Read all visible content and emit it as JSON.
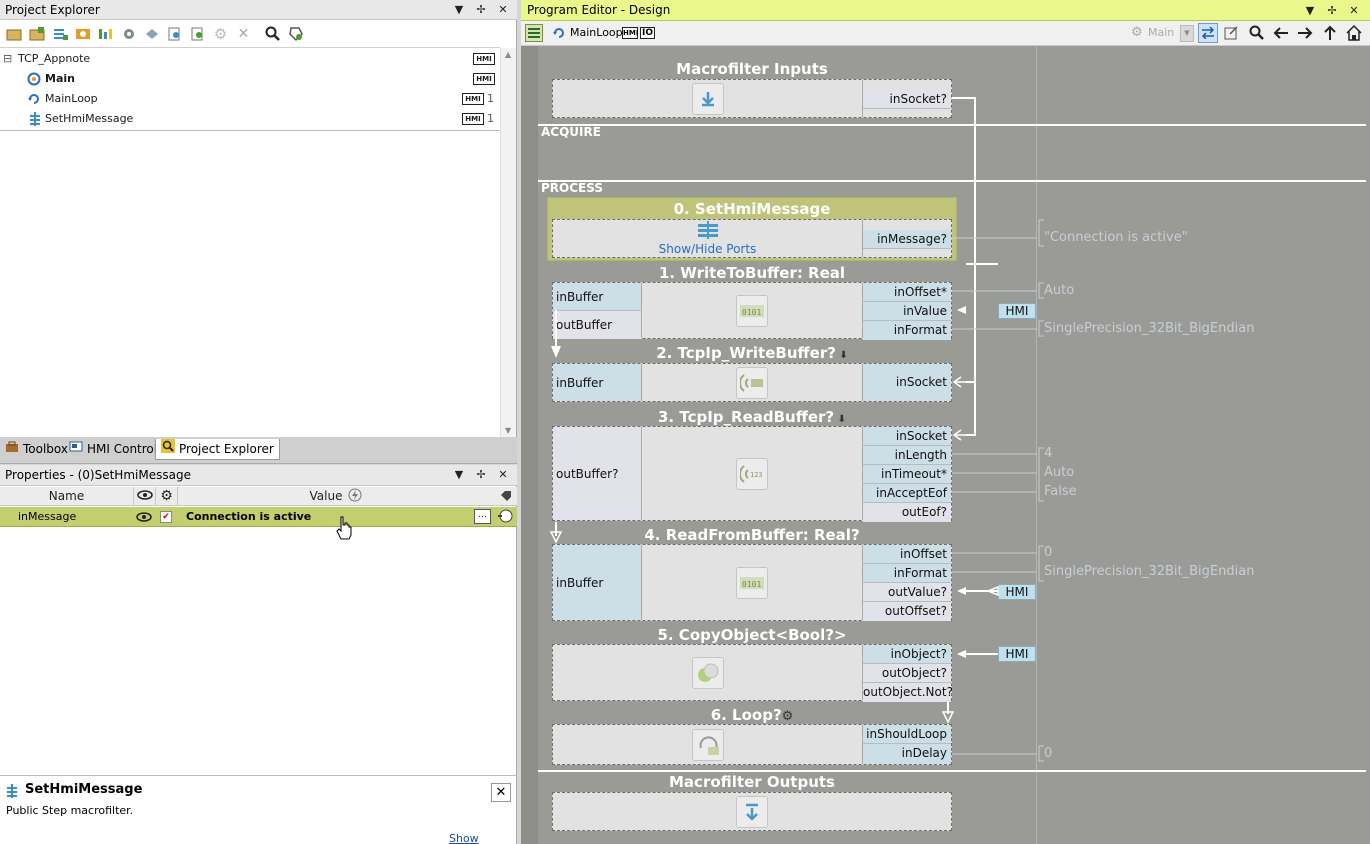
{
  "project_explorer": {
    "title": "Project Explorer",
    "tree": [
      {
        "label": "TCP_Appnote",
        "badge": "HMI",
        "count": ""
      },
      {
        "label": "Main",
        "badge": "HMI",
        "count": ""
      },
      {
        "label": "MainLoop",
        "badge": "HMI",
        "count": "1"
      },
      {
        "label": "SetHmiMessage",
        "badge": "HMI",
        "count": "1"
      }
    ],
    "expander": "⊟"
  },
  "tabs": [
    "Toolbox",
    "HMI Controls",
    "Project Explorer"
  ],
  "properties": {
    "title": "Properties - (0)SetHmiMessage",
    "col_name": "Name",
    "col_value": "Value",
    "row": {
      "name": "inMessage",
      "value": "Connection is active",
      "ellipsis": "..."
    }
  },
  "help": {
    "title": "SetHmiMessage",
    "description": "Public Step macrofilter.",
    "link": "Show help..."
  },
  "editor": {
    "title": "Program Editor - Design",
    "breadcrumb": "MainLoop",
    "hmi_badge": "HMI",
    "io_badge": "IO",
    "main_selector": "Main",
    "sections": {
      "acquire": "ACQUIRE",
      "process": "PROCESS"
    },
    "inputs_title": "Macrofilter Inputs",
    "outputs_title": "Macrofilter Outputs",
    "inputs_port": "inSocket?",
    "show_hide": "Show/Hide Ports",
    "hmi_label": "HMI",
    "filters": [
      {
        "title": "0. SetHmiMessage",
        "left": [],
        "right": [
          "inMessage?"
        ],
        "values": [
          "\"Connection is active\""
        ]
      },
      {
        "title": "1. WriteToBuffer: Real",
        "left": [
          "inBuffer",
          "outBuffer"
        ],
        "right": [
          "inOffset*",
          "inValue",
          "inFormat"
        ],
        "values": [
          "Auto",
          "",
          "SinglePrecision_32Bit_BigEndian"
        ]
      },
      {
        "title": "2. TcpIp_WriteBuffer?",
        "left": [
          "inBuffer"
        ],
        "right": [
          "inSocket"
        ],
        "values": []
      },
      {
        "title": "3. TcpIp_ReadBuffer?",
        "left": [
          "outBuffer?"
        ],
        "right": [
          "inSocket",
          "inLength",
          "inTimeout*",
          "inAcceptEof",
          "outEof?"
        ],
        "values": [
          "",
          "4",
          "Auto",
          "False"
        ]
      },
      {
        "title": "4. ReadFromBuffer: Real?",
        "left": [
          "inBuffer"
        ],
        "right": [
          "inOffset",
          "inFormat",
          "outValue?",
          "outOffset?"
        ],
        "values": [
          "0",
          "SinglePrecision_32Bit_BigEndian"
        ]
      },
      {
        "title": "5. CopyObject<Bool?>",
        "left": [],
        "right": [
          "inObject?",
          "outObject?",
          "outObject.Not?"
        ],
        "values": []
      },
      {
        "title": "6. Loop?",
        "left": [],
        "right": [
          "inShouldLoop",
          "inDelay"
        ],
        "values": [
          "",
          "0"
        ]
      }
    ]
  },
  "colors": {
    "editor_bg": "#9a9a96",
    "title_bar": "#e8f88a",
    "setmsg_bg": "#c0c47a",
    "selected_row": "#c3cf6f",
    "port_blue": "#ccdfe7"
  }
}
